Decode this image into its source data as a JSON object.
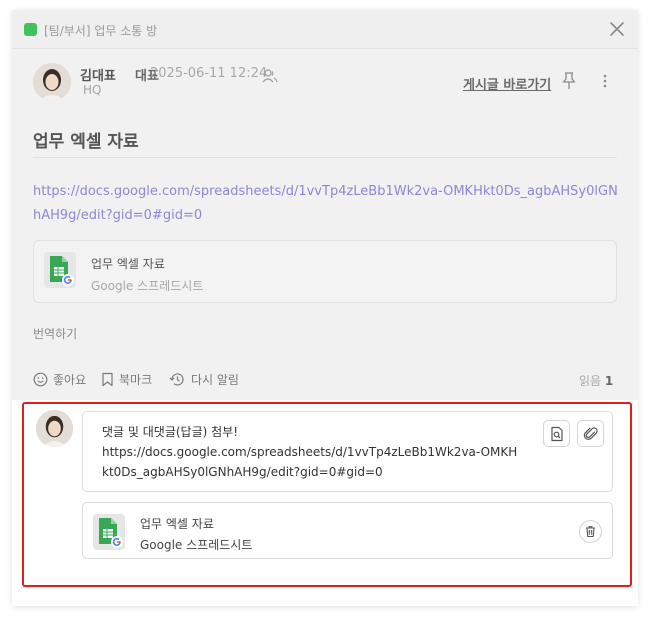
{
  "header": {
    "room_title": "[팀/부서] 업무 소통 방",
    "accent_color": "#41c35b"
  },
  "post": {
    "author_name": "김대표",
    "author_role": "대표",
    "time": "2025-06-11 12:24",
    "department": "HQ",
    "goto_link": "게시글 바로가기",
    "title": "업무 엑셀 자료",
    "link": "https://docs.google.com/spreadsheets/d/1vvTp4zLeBb1Wk2va-OMKHkt0Ds_agbAHSy0lGNhAH9g/edit?gid=0#gid=0",
    "attachment": {
      "name": "업무 엑셀 자료",
      "type": "Google 스프레드시트",
      "icon": "google-sheets-icon"
    },
    "translate": "번역하기",
    "actions": {
      "like": "좋아요",
      "bookmark": "북마크",
      "remind": "다시 알림"
    },
    "read_label": "읽음",
    "read_count": "1"
  },
  "comment": {
    "text": "댓글 및 대댓글(답글) 첨부!\nhttps://docs.google.com/spreadsheets/d/1vvTp4zLeBb1Wk2va-OMKHkt0Ds_agbAHSy0lGNhAH9g/edit?gid=0#gid=0",
    "attachment": {
      "name": "업무 엑셀 자료",
      "type": "Google 스프레드시트",
      "icon": "google-sheets-icon"
    },
    "tools": [
      "doc-search-icon",
      "paperclip-icon"
    ],
    "highlight_color": "#e01e1e"
  }
}
